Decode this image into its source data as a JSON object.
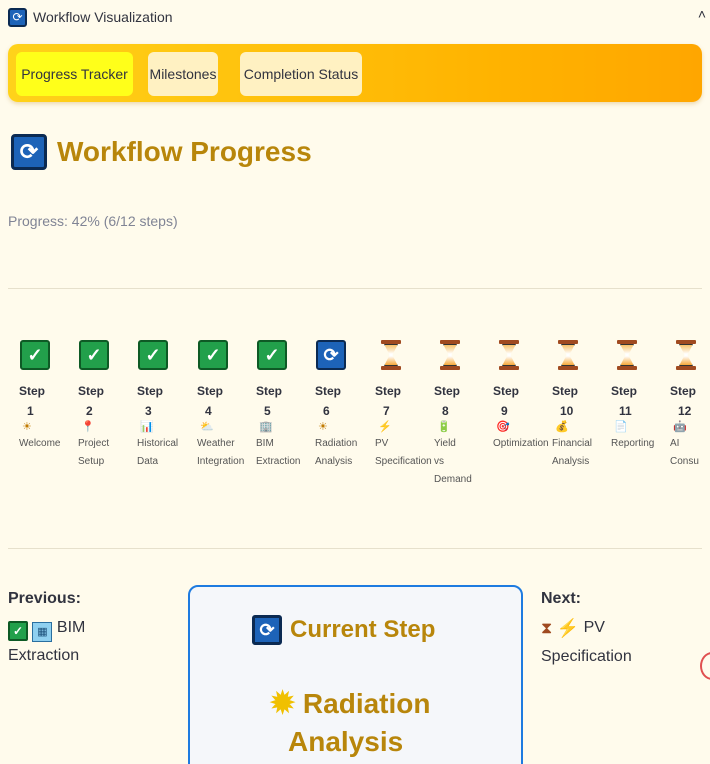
{
  "expander": {
    "title": "Workflow Visualization",
    "icon": "refresh-icon",
    "chevron": "˄"
  },
  "tabs": [
    {
      "label": "Progress Tracker",
      "active": true
    },
    {
      "label": "Milestones",
      "active": false
    },
    {
      "label": "Completion Status",
      "active": false
    }
  ],
  "header": {
    "title": "Workflow Progress",
    "icon": "refresh-icon"
  },
  "progress": {
    "text": "Progress: 42% (6/12 steps)",
    "percent": 42,
    "done": 6,
    "total": 12
  },
  "steps": [
    {
      "word": "Step",
      "num": "1",
      "emoji": "☀",
      "label1": "Welcome",
      "label2": "",
      "label3": "",
      "status": "done"
    },
    {
      "word": "Step",
      "num": "2",
      "emoji": "📍",
      "label1": "Project",
      "label2": "Setup",
      "label3": "",
      "status": "done"
    },
    {
      "word": "Step",
      "num": "3",
      "emoji": "📊",
      "label1": "Historical",
      "label2": "Data",
      "label3": "",
      "status": "done"
    },
    {
      "word": "Step",
      "num": "4",
      "emoji": "⛅",
      "label1": "Weather",
      "label2": "Integration",
      "label3": "",
      "status": "done"
    },
    {
      "word": "Step",
      "num": "5",
      "emoji": "🏢",
      "label1": "BIM",
      "label2": "Extraction",
      "label3": "",
      "status": "done"
    },
    {
      "word": "Step",
      "num": "6",
      "emoji": "☀",
      "label1": "Radiation",
      "label2": "Analysis",
      "label3": "",
      "status": "current"
    },
    {
      "word": "Step",
      "num": "7",
      "emoji": "⚡",
      "label1": "PV",
      "label2": "Specification",
      "label3": "",
      "status": "waiting"
    },
    {
      "word": "Step",
      "num": "8",
      "emoji": "🔋",
      "label1": "Yield",
      "label2": "vs",
      "label3": "Demand",
      "status": "waiting"
    },
    {
      "word": "Step",
      "num": "9",
      "emoji": "🎯",
      "label1": "Optimization",
      "label2": "",
      "label3": "",
      "status": "waiting"
    },
    {
      "word": "Step",
      "num": "10",
      "emoji": "💰",
      "label1": "Financial",
      "label2": "Analysis",
      "label3": "",
      "status": "waiting"
    },
    {
      "word": "Step",
      "num": "11",
      "emoji": "📄",
      "label1": "Reporting",
      "label2": "",
      "label3": "",
      "status": "waiting"
    },
    {
      "word": "Step",
      "num": "12",
      "emoji": "🤖",
      "label1": "AI",
      "label2": "Consu",
      "label3": "",
      "status": "waiting"
    }
  ],
  "previous": {
    "heading": "Previous:",
    "name_part1": "BIM",
    "name_part2": "Extraction"
  },
  "next": {
    "heading": "Next:",
    "name_part1": "PV",
    "name_part2": "Specification"
  },
  "current": {
    "heading": "Current Step",
    "name_part1": "Radiation",
    "name_part2": "Analysis"
  },
  "colors": {
    "accent": "#b8860b",
    "done": "#22a04b",
    "current": "#1d63b8",
    "tab_gradient_start": "#ffd21a",
    "tab_gradient_end": "#ffa600"
  }
}
